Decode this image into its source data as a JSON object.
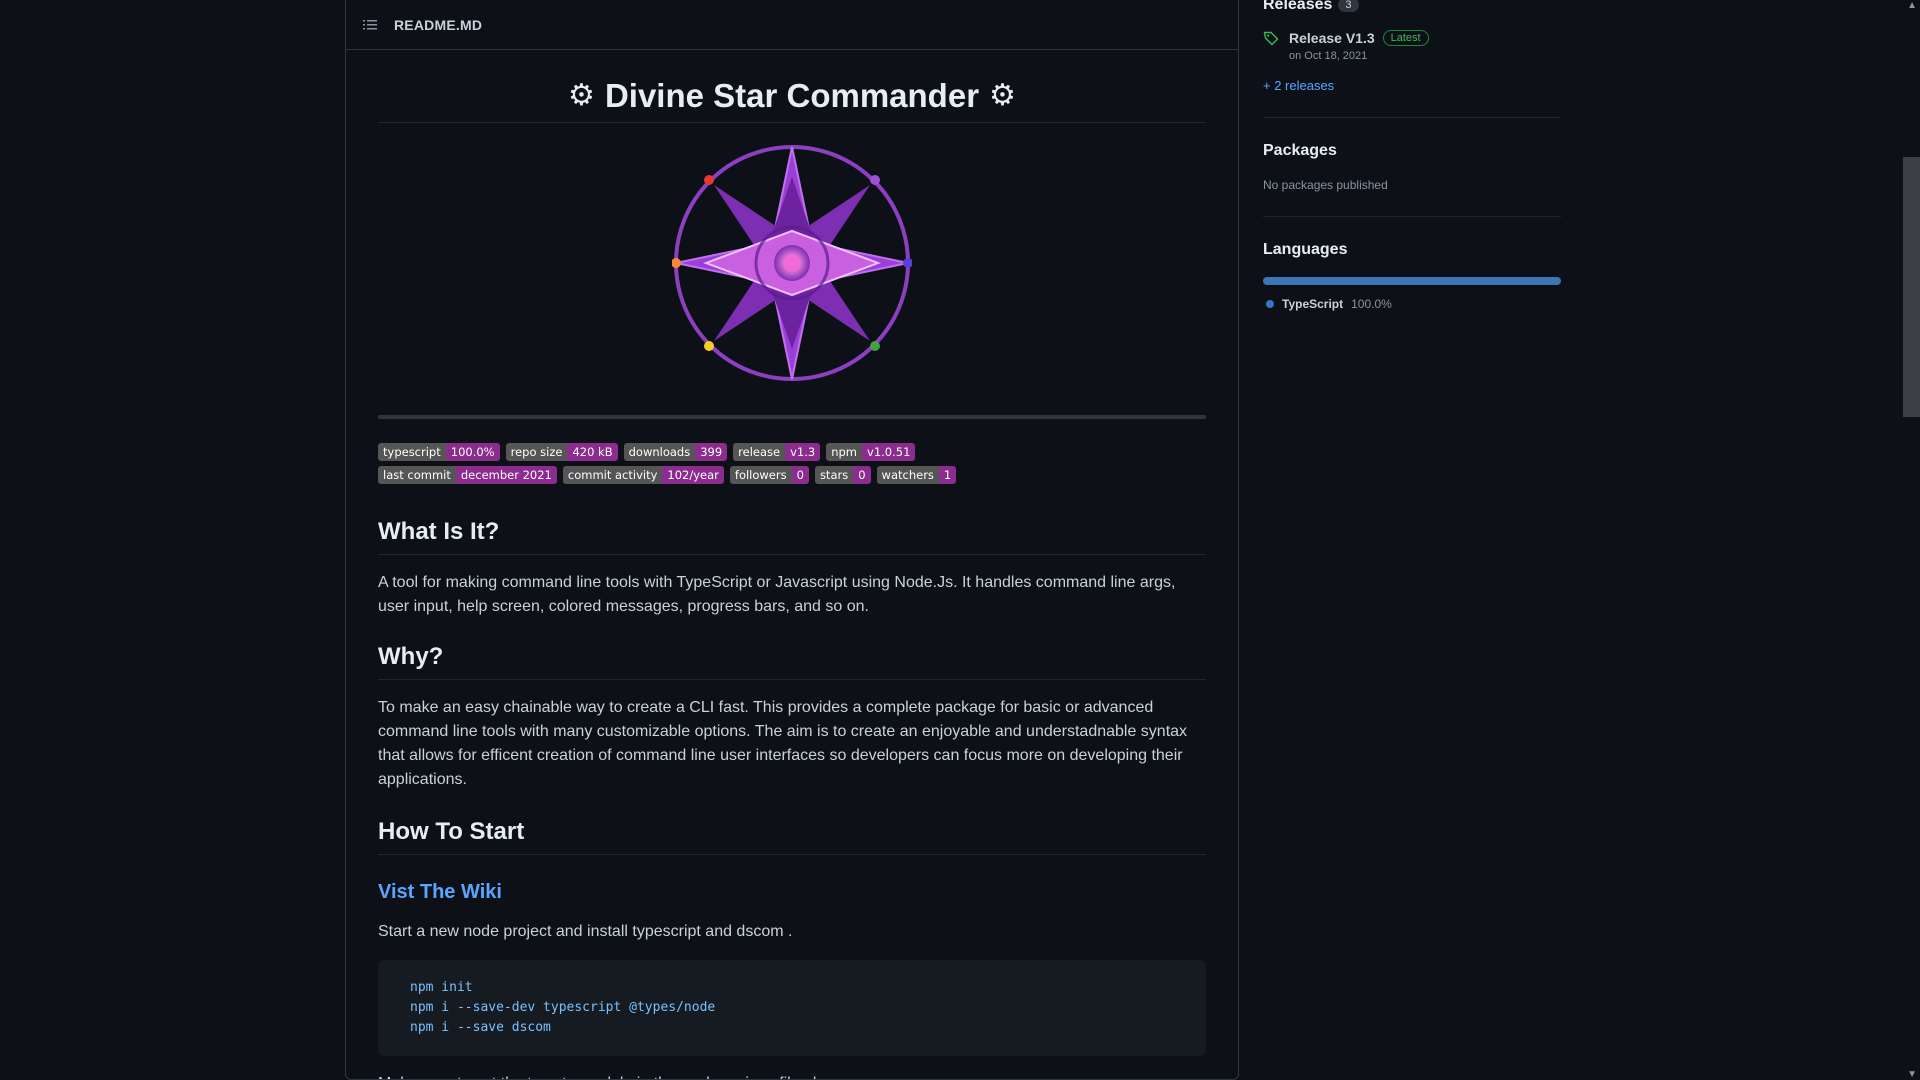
{
  "readme": {
    "filename": "README.MD",
    "title": "Divine Star Commander",
    "title_gear_glyph": "⚙",
    "badges": [
      {
        "label": "typescript",
        "value": "100.0%"
      },
      {
        "label": "repo size",
        "value": "420 kB"
      },
      {
        "label": "downloads",
        "value": "399"
      },
      {
        "label": "release",
        "value": "v1.3"
      },
      {
        "label": "npm",
        "value": "v1.0.51"
      },
      {
        "label": "last commit",
        "value": "december 2021"
      },
      {
        "label": "commit activity",
        "value": "102/year"
      },
      {
        "label": "followers",
        "value": "0"
      },
      {
        "label": "stars",
        "value": "0"
      },
      {
        "label": "watchers",
        "value": "1"
      }
    ],
    "badge_value_color": "#8b2c8e",
    "section_what": {
      "heading": "What Is It?",
      "body": "A tool for making command line tools with TypeScript or Javascript using Node.Js. It handles command line args, user input, help screen, colored messages, progress bars, and so on."
    },
    "section_why": {
      "heading": "Why?",
      "body": "To make an easy chainable way to create a CLI fast. This provides a complete package for basic or advanced command line tools with many customizable options. The aim is to create an enjoyable and understadnable syntax that allows for efficent creation of command line user interfaces so developers can focus more on developing their applications."
    },
    "section_start": {
      "heading": "How To Start",
      "wiki_link": "Vist The Wiki",
      "intro": "Start a new node project and install typescript and dscom .",
      "code": [
        "npm init",
        "npm i --save-dev typescript @types/node",
        "npm i --save dscom"
      ],
      "after": "Make sure to set the type to module in the package.json file also."
    }
  },
  "sidebar": {
    "releases": {
      "title": "Releases",
      "count": "3",
      "latest_name": "Release V1.3",
      "latest_badge": "Latest",
      "date": "on Oct 18, 2021",
      "more": "+ 2 releases"
    },
    "packages": {
      "title": "Packages",
      "empty": "No packages published"
    },
    "languages": {
      "title": "Languages",
      "items": [
        {
          "name": "TypeScript",
          "percent": "100.0%",
          "color": "#3178c6"
        }
      ]
    }
  },
  "icons": {
    "list": "list-icon",
    "tag": "tag-icon",
    "gear": "gear-icon"
  }
}
